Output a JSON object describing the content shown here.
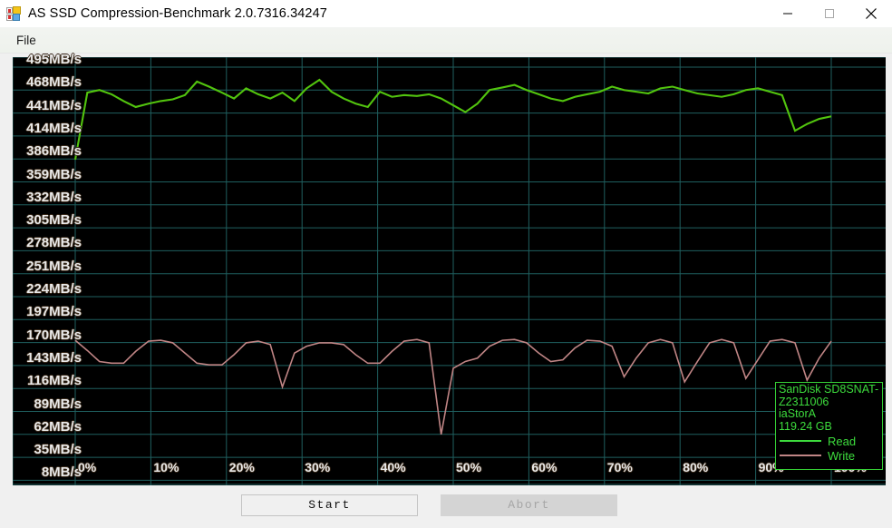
{
  "window": {
    "title": "AS SSD Compression-Benchmark 2.0.7316.34247",
    "icon": "app-blocks-icon",
    "controls": {
      "minimize": "minimize-icon",
      "maximize": "maximize-icon",
      "close": "close-icon"
    }
  },
  "menubar": {
    "items": [
      {
        "label": "File"
      }
    ]
  },
  "buttons": {
    "start": "Start",
    "abort": "Abort"
  },
  "legend": {
    "device_line1": "SanDisk SD8SNAT-",
    "device_line2": "Z2311006",
    "driver": "iaStorA",
    "capacity": "119.24 GB",
    "read_label": "Read",
    "write_label": "Write",
    "read_color": "#52c40e",
    "write_color": "#c08585",
    "border_color": "#35d035",
    "text_color": "#3ddc3d"
  },
  "chart_data": {
    "type": "line",
    "title": "",
    "xlabel": "",
    "ylabel": "",
    "grid": true,
    "background": "#000000",
    "grid_color": "#1f5f5f",
    "ylim": [
      8,
      495
    ],
    "xlim": [
      0,
      100
    ],
    "ytick_labels": [
      "495MB/s",
      "468MB/s",
      "441MB/s",
      "414MB/s",
      "386MB/s",
      "359MB/s",
      "332MB/s",
      "305MB/s",
      "278MB/s",
      "251MB/s",
      "224MB/s",
      "197MB/s",
      "170MB/s",
      "143MB/s",
      "116MB/s",
      "89MB/s",
      "62MB/s",
      "35MB/s",
      "8MB/s"
    ],
    "ytick_values": [
      495,
      468,
      441,
      414,
      386,
      359,
      332,
      305,
      278,
      251,
      224,
      197,
      170,
      143,
      116,
      89,
      62,
      35,
      8
    ],
    "xtick_labels": [
      "0%",
      "10%",
      "20%",
      "30%",
      "40%",
      "50%",
      "60%",
      "70%",
      "80%",
      "90%",
      "100%"
    ],
    "xtick_values": [
      0,
      10,
      20,
      30,
      40,
      50,
      60,
      70,
      80,
      90,
      100
    ],
    "legend_position": "bottom-right",
    "x": [
      0,
      1.6,
      3.2,
      4.8,
      6.4,
      8,
      9.7,
      11.3,
      12.9,
      14.5,
      16.1,
      17.7,
      19.4,
      21,
      22.6,
      24.2,
      25.8,
      27.4,
      29,
      30.6,
      32.3,
      33.9,
      35.5,
      37.1,
      38.7,
      40.3,
      41.9,
      43.5,
      45.2,
      46.8,
      48.4,
      50,
      51.6,
      53.2,
      54.8,
      56.5,
      58.1,
      59.7,
      61.3,
      62.9,
      64.5,
      66.1,
      67.7,
      69.4,
      71,
      72.6,
      74.2,
      75.8,
      77.4,
      79,
      80.6,
      82.3,
      83.9,
      85.5,
      87.1,
      88.7,
      90.3,
      91.9,
      93.5,
      95.2,
      96.8,
      98.4,
      100
    ],
    "series": [
      {
        "name": "Read",
        "color": "#52c40e",
        "values": [
          386,
          465,
          468,
          463,
          455,
          448,
          452,
          455,
          457,
          462,
          478,
          472,
          465,
          458,
          470,
          463,
          458,
          465,
          455,
          470,
          480,
          466,
          458,
          452,
          448,
          466,
          460,
          462,
          461,
          463,
          458,
          450,
          442,
          452,
          468,
          471,
          474,
          468,
          463,
          458,
          455,
          460,
          463,
          466,
          472,
          468,
          466,
          464,
          470,
          472,
          468,
          464,
          462,
          460,
          463,
          468,
          470,
          466,
          462,
          420,
          428,
          434,
          437
        ]
      },
      {
        "name": "Write",
        "color": "#c08585",
        "values": [
          173,
          161,
          148,
          146,
          146,
          160,
          172,
          173,
          170,
          158,
          146,
          144,
          144,
          156,
          170,
          172,
          168,
          118,
          158,
          166,
          170,
          170,
          168,
          156,
          146,
          146,
          160,
          172,
          174,
          170,
          62,
          140,
          148,
          152,
          166,
          173,
          174,
          170,
          158,
          148,
          150,
          164,
          173,
          172,
          166,
          130,
          152,
          170,
          174,
          170,
          124,
          148,
          170,
          174,
          170,
          128,
          150,
          172,
          174,
          170,
          126,
          152,
          172
        ]
      }
    ]
  }
}
